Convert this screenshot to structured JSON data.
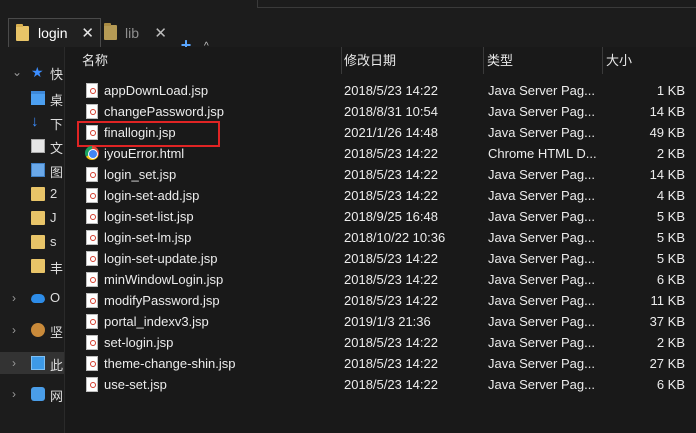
{
  "tabs": [
    {
      "label": "login",
      "active": true
    },
    {
      "label": "lib",
      "active": false
    }
  ],
  "nav": [
    {
      "label": "快",
      "icon": "star-icon",
      "expanded": true
    },
    {
      "label": "桌",
      "icon": "desktop-icon"
    },
    {
      "label": "下",
      "icon": "download-icon"
    },
    {
      "label": "文",
      "icon": "document-icon"
    },
    {
      "label": "图",
      "icon": "picture-icon"
    },
    {
      "label": "2",
      "icon": "folder-icon"
    },
    {
      "label": "J",
      "icon": "folder-icon"
    },
    {
      "label": "s",
      "icon": "folder-icon"
    },
    {
      "label": "丰",
      "icon": "folder-icon"
    },
    {
      "label": "O",
      "icon": "onedrive-icon"
    },
    {
      "label": "坚",
      "icon": "nutstore-icon"
    },
    {
      "label": "此",
      "icon": "this-pc-icon",
      "selected": true
    },
    {
      "label": "网",
      "icon": "network-icon"
    }
  ],
  "columns": {
    "name": "名称",
    "date": "修改日期",
    "type": "类型",
    "size": "大小"
  },
  "files": [
    {
      "name": "appDownLoad.jsp",
      "date": "2018/5/23 14:22",
      "type": "Java Server Pag...",
      "size": "1 KB",
      "icon": "jsp-file-icon"
    },
    {
      "name": "changePassword.jsp",
      "date": "2018/8/31 10:54",
      "type": "Java Server Pag...",
      "size": "14 KB",
      "icon": "jsp-file-icon"
    },
    {
      "name": "finallogin.jsp",
      "date": "2021/1/26 14:48",
      "type": "Java Server Pag...",
      "size": "49 KB",
      "icon": "jsp-file-icon",
      "highlighted": true
    },
    {
      "name": "iyouError.html",
      "date": "2018/5/23 14:22",
      "type": "Chrome HTML D...",
      "size": "2 KB",
      "icon": "chrome-html-icon"
    },
    {
      "name": "login_set.jsp",
      "date": "2018/5/23 14:22",
      "type": "Java Server Pag...",
      "size": "14 KB",
      "icon": "jsp-file-icon"
    },
    {
      "name": "login-set-add.jsp",
      "date": "2018/5/23 14:22",
      "type": "Java Server Pag...",
      "size": "4 KB",
      "icon": "jsp-file-icon"
    },
    {
      "name": "login-set-list.jsp",
      "date": "2018/9/25 16:48",
      "type": "Java Server Pag...",
      "size": "5 KB",
      "icon": "jsp-file-icon"
    },
    {
      "name": "login-set-lm.jsp",
      "date": "2018/10/22 10:36",
      "type": "Java Server Pag...",
      "size": "5 KB",
      "icon": "jsp-file-icon"
    },
    {
      "name": "login-set-update.jsp",
      "date": "2018/5/23 14:22",
      "type": "Java Server Pag...",
      "size": "5 KB",
      "icon": "jsp-file-icon"
    },
    {
      "name": "minWindowLogin.jsp",
      "date": "2018/5/23 14:22",
      "type": "Java Server Pag...",
      "size": "6 KB",
      "icon": "jsp-file-icon"
    },
    {
      "name": "modifyPassword.jsp",
      "date": "2018/5/23 14:22",
      "type": "Java Server Pag...",
      "size": "11 KB",
      "icon": "jsp-file-icon"
    },
    {
      "name": "portal_indexv3.jsp",
      "date": "2019/1/3 21:36",
      "type": "Java Server Pag...",
      "size": "37 KB",
      "icon": "jsp-file-icon"
    },
    {
      "name": "set-login.jsp",
      "date": "2018/5/23 14:22",
      "type": "Java Server Pag...",
      "size": "2 KB",
      "icon": "jsp-file-icon"
    },
    {
      "name": "theme-change-shin.jsp",
      "date": "2018/5/23 14:22",
      "type": "Java Server Pag...",
      "size": "27 KB",
      "icon": "jsp-file-icon"
    },
    {
      "name": "use-set.jsp",
      "date": "2018/5/23 14:22",
      "type": "Java Server Pag...",
      "size": "6 KB",
      "icon": "jsp-file-icon"
    }
  ]
}
